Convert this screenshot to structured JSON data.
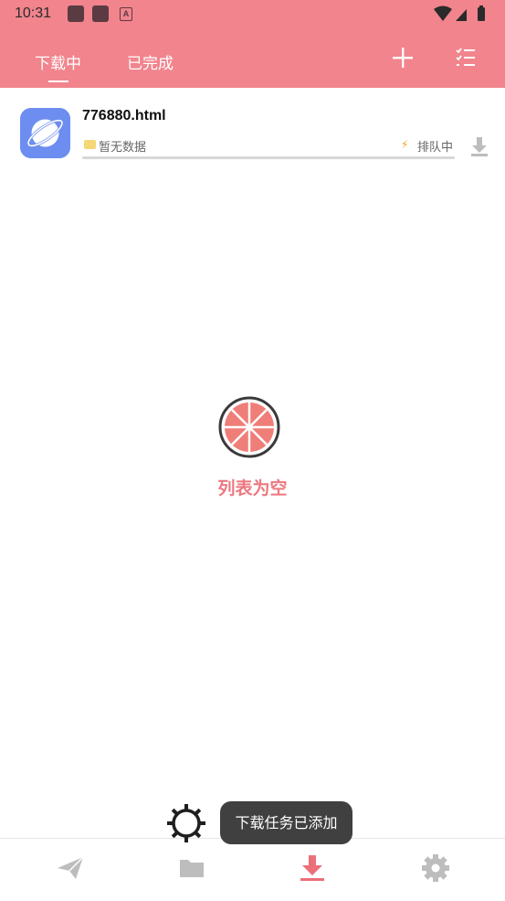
{
  "status_bar": {
    "time": "10:31"
  },
  "tabs": [
    {
      "label": "下载中",
      "active": true
    },
    {
      "label": "已完成",
      "active": false
    }
  ],
  "header_actions": {
    "add_icon": "plus-icon",
    "list_icon": "checklist-icon"
  },
  "download_item": {
    "file_name": "776880.html",
    "path_text": "暂无数据",
    "status_text": "排队中",
    "progress": 0
  },
  "empty_state": {
    "text": "列表为空"
  },
  "bottom_nav": [
    {
      "name": "send-icon",
      "active": false
    },
    {
      "name": "folder-icon",
      "active": false
    },
    {
      "name": "download-icon",
      "active": true
    },
    {
      "name": "settings-icon",
      "active": false
    }
  ],
  "toast": {
    "text": "下载任务已添加"
  },
  "colors": {
    "accent": "#f1848d",
    "active_nav": "#ec6f79",
    "inactive_nav": "#bdbdbd"
  }
}
